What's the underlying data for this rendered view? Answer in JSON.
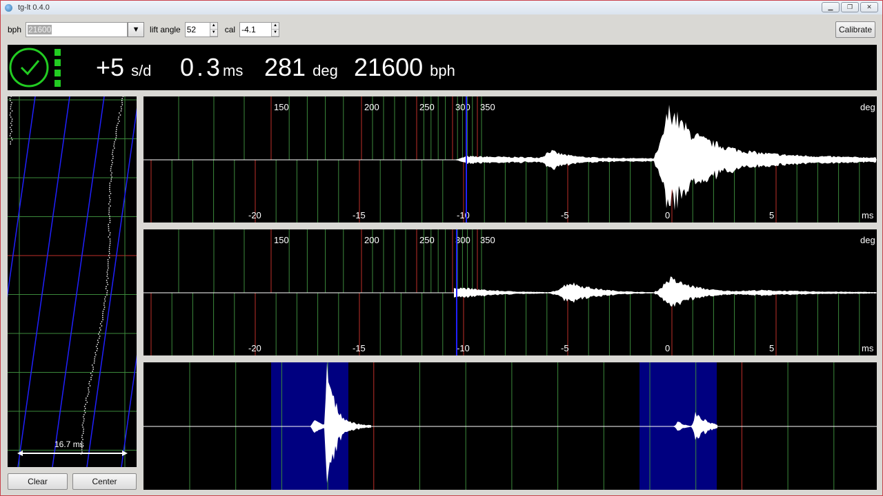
{
  "window": {
    "title": "tg-lt 0.4.0",
    "controls": [
      "minimize",
      "restore",
      "close"
    ]
  },
  "toolbar": {
    "bph_label": "bph",
    "bph_value": "21600",
    "lift_label": "lift angle",
    "lift_value": "52",
    "cal_label": "cal",
    "cal_value": "-4.1",
    "calibrate_label": "Calibrate"
  },
  "status": {
    "rate": "+5",
    "rate_unit": "s/d",
    "beat_error": "0.3",
    "beat_error_unit": "ms",
    "amplitude": "281",
    "amplitude_unit": "deg",
    "bph": "21600",
    "bph_unit": "bph",
    "signal_level": 4,
    "signal_color": "#22cc22"
  },
  "paper": {
    "span_label": "16.7 ms",
    "clear_label": "Clear",
    "center_label": "Center"
  },
  "scopes": {
    "deg_ticks": [
      "150",
      "200",
      "250",
      "300",
      "350"
    ],
    "deg_unit": "deg",
    "ms_ticks": [
      "-20",
      "-15",
      "-10",
      "-5",
      "0",
      "5"
    ],
    "ms_unit": "ms"
  },
  "colors": {
    "grid": "#3c8a3c",
    "major": "#c0302a",
    "marker": "#2020ff",
    "band": "#000080",
    "wave": "#ffffff"
  }
}
